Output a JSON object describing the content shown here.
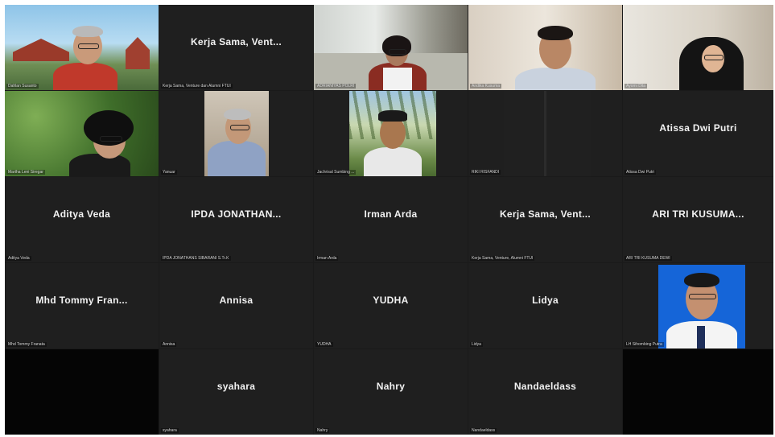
{
  "participants": [
    {
      "tag": "Dahlan Susanto",
      "display": ""
    },
    {
      "tag": "Kerja Sama, Venture dan Alumni FTUI",
      "display": "Kerja Sama, Vent..."
    },
    {
      "tag": "ADRIANIYAS POLRI",
      "display": ""
    },
    {
      "tag": "Andika Kusuma",
      "display": ""
    },
    {
      "tag": "Ayomi Dita",
      "display": ""
    },
    {
      "tag": "Martha Leni Siregar",
      "display": ""
    },
    {
      "tag": "Yanuar",
      "display": ""
    },
    {
      "tag": "Jachrisal Sumbing ...",
      "display": ""
    },
    {
      "tag": "RIKI RISFANDI",
      "display": ""
    },
    {
      "tag": "Atissa Dwi Putri",
      "display": "Atissa Dwi Putri"
    },
    {
      "tag": "Aditya Veda",
      "display": "Aditya Veda"
    },
    {
      "tag": "IPDA JONATHANS SIBARANI S.Tr.K",
      "display": "IPDA JONATHAN..."
    },
    {
      "tag": "Irman Arda",
      "display": "Irman Arda"
    },
    {
      "tag": "Kerja Sama, Venture, Alumni FTUI",
      "display": "Kerja Sama, Vent..."
    },
    {
      "tag": "ARI TRI KUSUMA DEWI",
      "display": "ARI TRI KUSUMA..."
    },
    {
      "tag": "Mhd Tommy Franata",
      "display": "Mhd Tommy Fran..."
    },
    {
      "tag": "Annisa",
      "display": "Annisa"
    },
    {
      "tag": "YUDHA",
      "display": "YUDHA"
    },
    {
      "tag": "Lidya",
      "display": "Lidya"
    },
    {
      "tag": "LH Sihombing Putra",
      "display": ""
    },
    {
      "tag": "syahara",
      "display": "syahara"
    },
    {
      "tag": "Nahry",
      "display": "Nahry"
    },
    {
      "tag": "Nandaeldass",
      "display": "Nandaeldass"
    }
  ],
  "colors": {
    "grid_bg": "#1a1a1a",
    "tile_bg": "#1f1f1f",
    "name_text": "#f2f2f2"
  }
}
